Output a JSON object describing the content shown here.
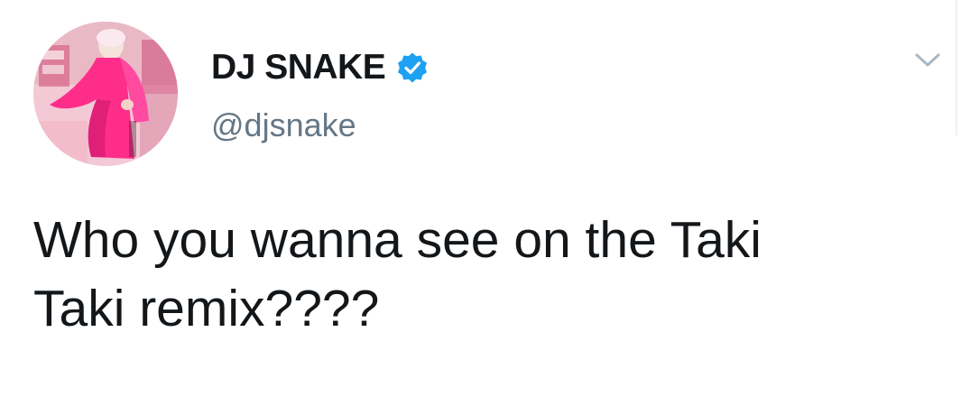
{
  "tweet": {
    "display_name": "DJ SNAKE",
    "handle": "@djsnake",
    "text": "Who you wanna see on the Taki\nTaki remix????",
    "verified": true
  },
  "icons": {
    "verified": "verified-badge-icon",
    "menu": "chevron-down-icon"
  },
  "colors": {
    "verified_blue": "#1da1f2",
    "text_primary": "#14171a",
    "text_secondary": "#657786",
    "chevron": "#aab8c2",
    "avatar_pink": "#ff2d8a"
  }
}
